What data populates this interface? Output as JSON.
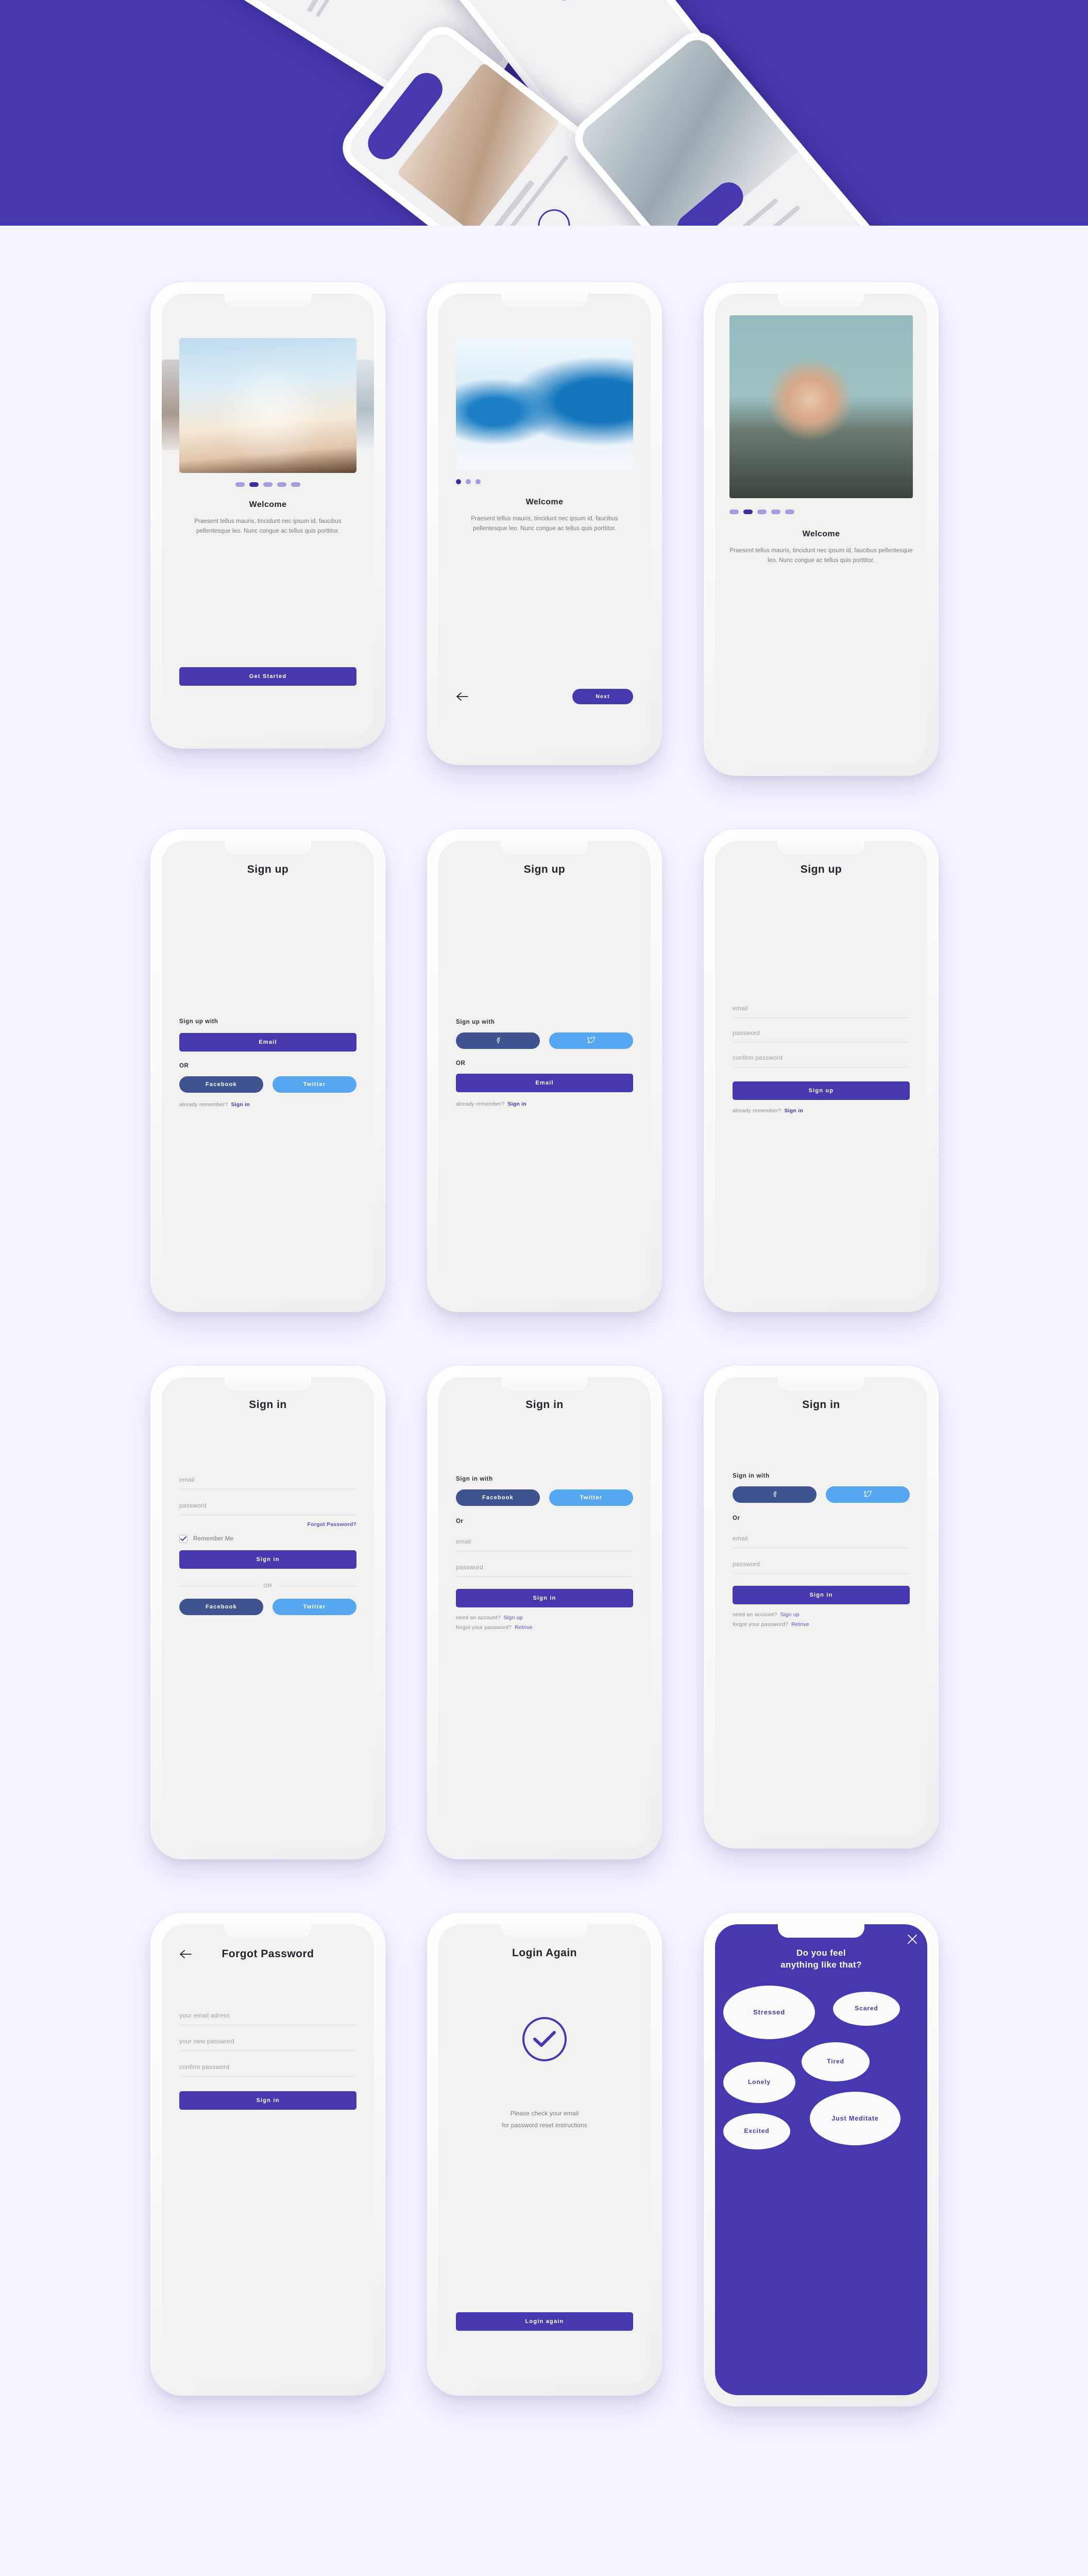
{
  "theme": {
    "page_background": "#f5f3ff",
    "hero_background": "#4639b0",
    "primary": "#4639b0",
    "facebook_blue": "#3f5390",
    "twitter_blue": "#56a7f0",
    "screen_background": "#f1f1f0",
    "dot_inactive": "#a79ce0",
    "dot_active": "#3b2fa0"
  },
  "onboarding": {
    "heading": "Welcome",
    "body": "Praesent tellus mauris, tincidunt nec ipsum id, faucibus pellentesque leo. Nunc congue ac tellus quis porttitor.",
    "get_started_label": "Get Started",
    "next_label": "Next",
    "back_icon": "arrow-left-icon",
    "slide1_dots": 5,
    "slide1_active": 1,
    "slide2_dots": 3,
    "slide2_active": 0,
    "slide3_dots": 5,
    "slide3_active": 1
  },
  "signup": {
    "title": "Sign up",
    "sign_up_with_label": "Sign up with",
    "or_label": "OR",
    "email_label": "Email",
    "facebook_label": "Facebook",
    "twitter_label": "Twitter",
    "facebook_icon": "facebook-icon",
    "twitter_icon": "twitter-icon",
    "already_remember_text": "already remember?",
    "sign_in_link": "Sign in",
    "submit_label": "Sign up",
    "fields": [
      {
        "placeholder": "email"
      },
      {
        "placeholder": "password"
      },
      {
        "placeholder": "confirm password"
      }
    ]
  },
  "signin": {
    "title": "Sign in",
    "sign_in_with_label": "Sign in with",
    "or_label": "Or",
    "or_divider_label": "OR",
    "facebook_label": "Facebook",
    "twitter_label": "Twitter",
    "facebook_icon": "facebook-icon",
    "twitter_icon": "twitter-icon",
    "submit_label": "Sign in",
    "forgot_password_link": "Forgot Password?",
    "remember_me_label": "Remember Me",
    "remember_me_checked": true,
    "need_account_text": "need an account?",
    "sign_up_link": "Sign up",
    "forgot_your_password_text": "forgot your password?",
    "retrive_link": "Retrive",
    "fields": [
      {
        "placeholder": "email"
      },
      {
        "placeholder": "password"
      }
    ]
  },
  "forgot_password": {
    "title": "Forgot Password",
    "back_icon": "arrow-left-icon",
    "submit_label": "Sign in",
    "fields": [
      {
        "placeholder": "your email adress"
      },
      {
        "placeholder": "your new password"
      },
      {
        "placeholder": "confirm password"
      }
    ]
  },
  "login_again": {
    "title": "Login Again",
    "success_icon": "check-circle-icon",
    "message_line1": "Please check your email",
    "message_line2": "for password reset instructions",
    "button_label": "Login again"
  },
  "mood": {
    "title_line1": "Do you feel",
    "title_line2": "anything like that?",
    "close_icon": "close-icon",
    "bubbles": [
      {
        "label": "Stressed"
      },
      {
        "label": "Scared"
      },
      {
        "label": "Tired"
      },
      {
        "label": "Lonely"
      },
      {
        "label": "Just Meditate"
      },
      {
        "label": "Excited"
      }
    ]
  }
}
